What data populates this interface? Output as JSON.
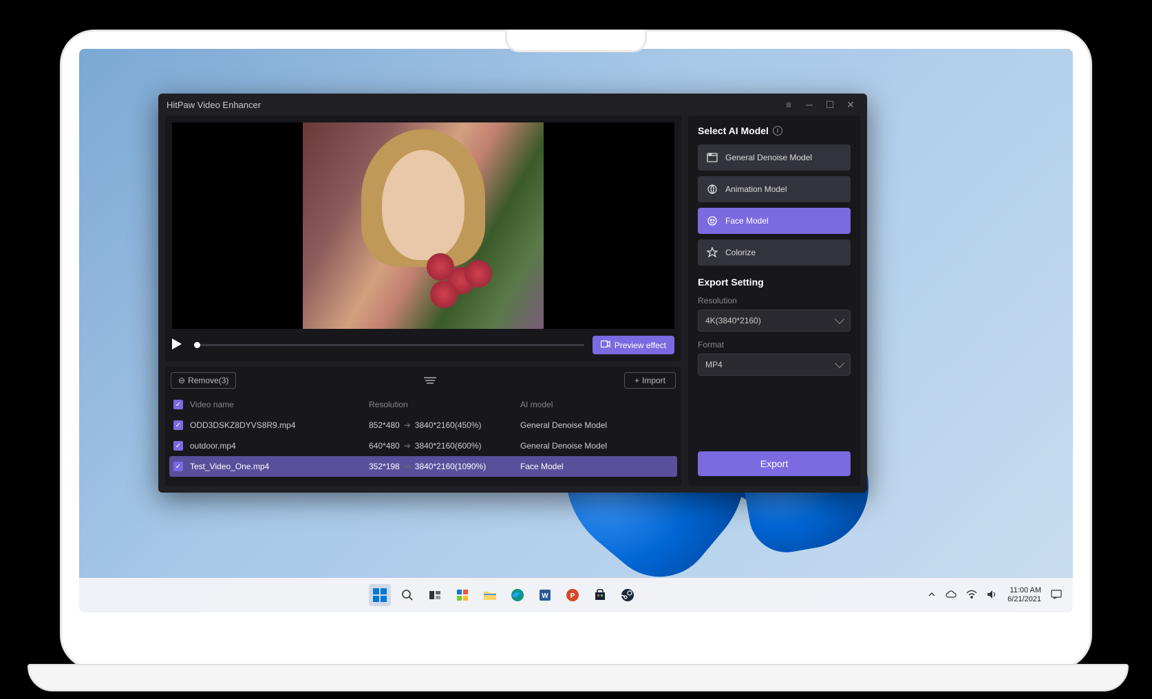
{
  "app": {
    "title": "HitPaw Video Enhancer",
    "preview_button": "Preview effect",
    "remove_button": "Remove(3)",
    "import_button": "Import",
    "columns": {
      "name": "Video name",
      "resolution": "Resolution",
      "model": "AI model"
    },
    "rows": [
      {
        "name": "ODD3DSKZ8DYVS8R9.mp4",
        "from": "852*480",
        "to": "3840*2160(450%)",
        "model": "General Denoise Model",
        "selected": false
      },
      {
        "name": "outdoor.mp4",
        "from": "640*480",
        "to": "3840*2160(600%)",
        "model": "General Denoise Model",
        "selected": false
      },
      {
        "name": "Test_Video_One.mp4",
        "from": "352*198",
        "to": "3840*2160(1090%)",
        "model": "Face Model",
        "selected": true
      }
    ],
    "sidebar": {
      "select_model": "Select AI Model",
      "models": [
        {
          "label": "General Denoise Model",
          "active": false
        },
        {
          "label": "Animation Model",
          "active": false
        },
        {
          "label": "Face Model",
          "active": true
        },
        {
          "label": "Colorize",
          "active": false
        }
      ],
      "export_setting": "Export Setting",
      "resolution_label": "Resolution",
      "resolution_value": "4K(3840*2160)",
      "format_label": "Format",
      "format_value": "MP4",
      "export_button": "Export"
    }
  },
  "taskbar": {
    "time": "11:00 AM",
    "date": "6/21/2021"
  },
  "colors": {
    "accent": "#7b6ae0",
    "window_bg": "#1f1f24",
    "panel_bg": "#18181c"
  }
}
